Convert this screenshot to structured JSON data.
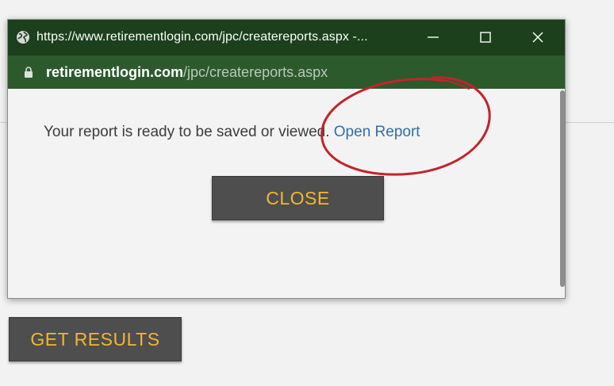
{
  "popup": {
    "title": "https://www.retirementlogin.com/jpc/createreports.aspx -...",
    "address": {
      "domain": "retirementlogin.com",
      "path": "/jpc/createreports.aspx"
    },
    "message": "Your report is ready to be saved or viewed.",
    "link_label": "Open Report",
    "close_label": "CLOSE",
    "icons": {
      "site": "globe-icon",
      "lock": "lock-icon",
      "minimize": "minimize-icon",
      "maximize": "maximize-icon",
      "close": "close-icon"
    }
  },
  "page": {
    "get_results_label": "GET RESULTS"
  },
  "colors": {
    "titlebar": "#1c3f1c",
    "addressbar": "#2d5a2d",
    "button_bg": "#4e4e4e",
    "button_text": "#f2b632",
    "link": "#2f6fa8",
    "annotation": "#c0242b"
  }
}
